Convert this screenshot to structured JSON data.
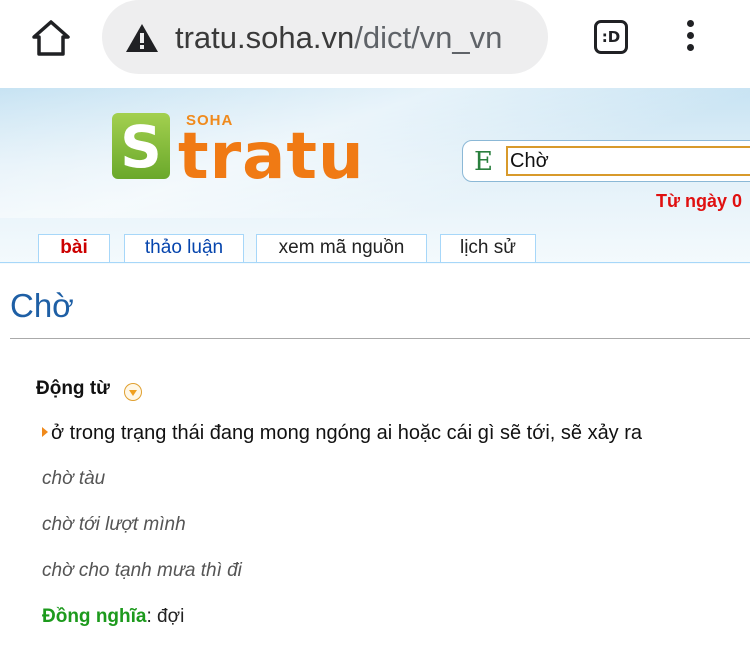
{
  "browser": {
    "url_host": "tratu.soha.vn",
    "url_path": "/dict/vn_vn",
    "tab_switcher_label": ":D"
  },
  "site": {
    "logo_letter": "S",
    "logo_soha": "SOHA",
    "logo_name": "tratu",
    "search_prefix": "E",
    "search_value": "Chờ",
    "notice_text": "Từ ngày 0"
  },
  "tabs": [
    {
      "label": "bài"
    },
    {
      "label": "thảo luận"
    },
    {
      "label": "xem mã nguồn"
    },
    {
      "label": "lịch sử"
    }
  ],
  "entry": {
    "title": "Chờ",
    "part_of_speech": "Động từ",
    "definition": "ở trong trạng thái đang mong ngóng ai hoặc cái gì sẽ tới, sẽ xảy ra",
    "examples": [
      "chờ tàu",
      "chờ tới lượt mình",
      "chờ cho tạnh mưa thì đi"
    ],
    "synonym_label": "Đồng nghĩa",
    "synonym_value": ": đợi"
  },
  "colors": {
    "title_blue": "#1e5fa5",
    "logo_orange": "#f07a14",
    "logo_green": "#6aa82b",
    "notice_red": "#e01010",
    "synonym_green": "#1d9a1d"
  }
}
